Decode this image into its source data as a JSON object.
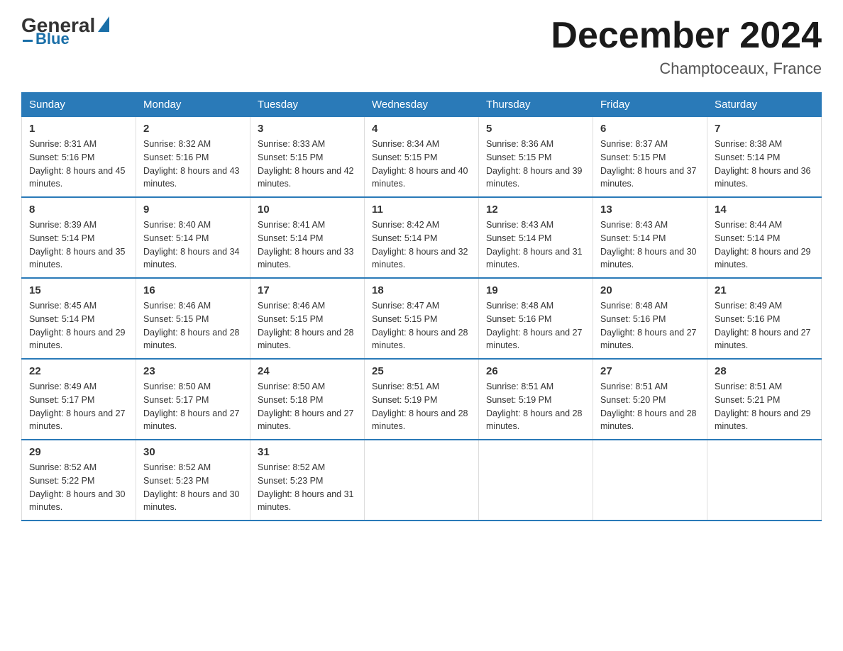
{
  "logo": {
    "general": "General",
    "blue": "Blue"
  },
  "title": "December 2024",
  "location": "Champtoceaux, France",
  "days_header": [
    "Sunday",
    "Monday",
    "Tuesday",
    "Wednesday",
    "Thursday",
    "Friday",
    "Saturday"
  ],
  "weeks": [
    [
      {
        "day": "1",
        "sunrise": "8:31 AM",
        "sunset": "5:16 PM",
        "daylight": "8 hours and 45 minutes."
      },
      {
        "day": "2",
        "sunrise": "8:32 AM",
        "sunset": "5:16 PM",
        "daylight": "8 hours and 43 minutes."
      },
      {
        "day": "3",
        "sunrise": "8:33 AM",
        "sunset": "5:15 PM",
        "daylight": "8 hours and 42 minutes."
      },
      {
        "day": "4",
        "sunrise": "8:34 AM",
        "sunset": "5:15 PM",
        "daylight": "8 hours and 40 minutes."
      },
      {
        "day": "5",
        "sunrise": "8:36 AM",
        "sunset": "5:15 PM",
        "daylight": "8 hours and 39 minutes."
      },
      {
        "day": "6",
        "sunrise": "8:37 AM",
        "sunset": "5:15 PM",
        "daylight": "8 hours and 37 minutes."
      },
      {
        "day": "7",
        "sunrise": "8:38 AM",
        "sunset": "5:14 PM",
        "daylight": "8 hours and 36 minutes."
      }
    ],
    [
      {
        "day": "8",
        "sunrise": "8:39 AM",
        "sunset": "5:14 PM",
        "daylight": "8 hours and 35 minutes."
      },
      {
        "day": "9",
        "sunrise": "8:40 AM",
        "sunset": "5:14 PM",
        "daylight": "8 hours and 34 minutes."
      },
      {
        "day": "10",
        "sunrise": "8:41 AM",
        "sunset": "5:14 PM",
        "daylight": "8 hours and 33 minutes."
      },
      {
        "day": "11",
        "sunrise": "8:42 AM",
        "sunset": "5:14 PM",
        "daylight": "8 hours and 32 minutes."
      },
      {
        "day": "12",
        "sunrise": "8:43 AM",
        "sunset": "5:14 PM",
        "daylight": "8 hours and 31 minutes."
      },
      {
        "day": "13",
        "sunrise": "8:43 AM",
        "sunset": "5:14 PM",
        "daylight": "8 hours and 30 minutes."
      },
      {
        "day": "14",
        "sunrise": "8:44 AM",
        "sunset": "5:14 PM",
        "daylight": "8 hours and 29 minutes."
      }
    ],
    [
      {
        "day": "15",
        "sunrise": "8:45 AM",
        "sunset": "5:14 PM",
        "daylight": "8 hours and 29 minutes."
      },
      {
        "day": "16",
        "sunrise": "8:46 AM",
        "sunset": "5:15 PM",
        "daylight": "8 hours and 28 minutes."
      },
      {
        "day": "17",
        "sunrise": "8:46 AM",
        "sunset": "5:15 PM",
        "daylight": "8 hours and 28 minutes."
      },
      {
        "day": "18",
        "sunrise": "8:47 AM",
        "sunset": "5:15 PM",
        "daylight": "8 hours and 28 minutes."
      },
      {
        "day": "19",
        "sunrise": "8:48 AM",
        "sunset": "5:16 PM",
        "daylight": "8 hours and 27 minutes."
      },
      {
        "day": "20",
        "sunrise": "8:48 AM",
        "sunset": "5:16 PM",
        "daylight": "8 hours and 27 minutes."
      },
      {
        "day": "21",
        "sunrise": "8:49 AM",
        "sunset": "5:16 PM",
        "daylight": "8 hours and 27 minutes."
      }
    ],
    [
      {
        "day": "22",
        "sunrise": "8:49 AM",
        "sunset": "5:17 PM",
        "daylight": "8 hours and 27 minutes."
      },
      {
        "day": "23",
        "sunrise": "8:50 AM",
        "sunset": "5:17 PM",
        "daylight": "8 hours and 27 minutes."
      },
      {
        "day": "24",
        "sunrise": "8:50 AM",
        "sunset": "5:18 PM",
        "daylight": "8 hours and 27 minutes."
      },
      {
        "day": "25",
        "sunrise": "8:51 AM",
        "sunset": "5:19 PM",
        "daylight": "8 hours and 28 minutes."
      },
      {
        "day": "26",
        "sunrise": "8:51 AM",
        "sunset": "5:19 PM",
        "daylight": "8 hours and 28 minutes."
      },
      {
        "day": "27",
        "sunrise": "8:51 AM",
        "sunset": "5:20 PM",
        "daylight": "8 hours and 28 minutes."
      },
      {
        "day": "28",
        "sunrise": "8:51 AM",
        "sunset": "5:21 PM",
        "daylight": "8 hours and 29 minutes."
      }
    ],
    [
      {
        "day": "29",
        "sunrise": "8:52 AM",
        "sunset": "5:22 PM",
        "daylight": "8 hours and 30 minutes."
      },
      {
        "day": "30",
        "sunrise": "8:52 AM",
        "sunset": "5:23 PM",
        "daylight": "8 hours and 30 minutes."
      },
      {
        "day": "31",
        "sunrise": "8:52 AM",
        "sunset": "5:23 PM",
        "daylight": "8 hours and 31 minutes."
      },
      {
        "day": "",
        "sunrise": "",
        "sunset": "",
        "daylight": ""
      },
      {
        "day": "",
        "sunrise": "",
        "sunset": "",
        "daylight": ""
      },
      {
        "day": "",
        "sunrise": "",
        "sunset": "",
        "daylight": ""
      },
      {
        "day": "",
        "sunrise": "",
        "sunset": "",
        "daylight": ""
      }
    ]
  ]
}
